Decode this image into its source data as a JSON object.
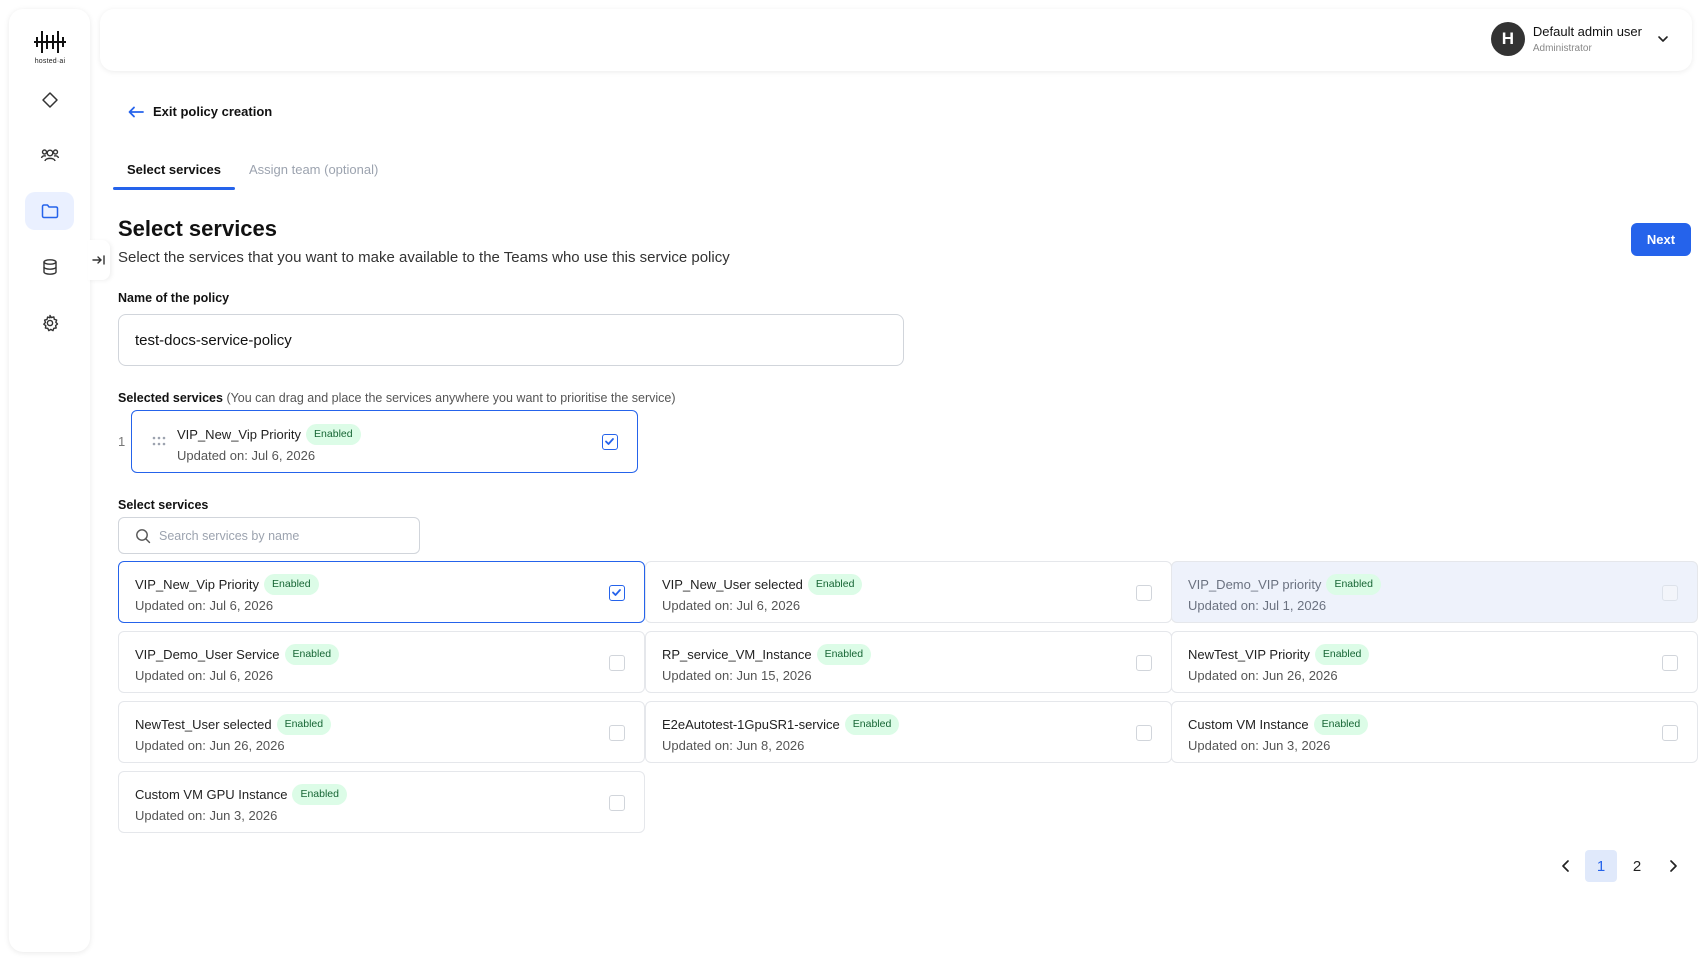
{
  "app": {
    "logo_text": "hosted·ai"
  },
  "sidebar": {
    "items": [
      {
        "name": "diamond-icon"
      },
      {
        "name": "users-icon"
      },
      {
        "name": "folder-icon",
        "active": true
      },
      {
        "name": "database-icon"
      },
      {
        "name": "gear-icon"
      }
    ],
    "collapse_icon": "collapse-right-icon"
  },
  "header": {
    "user": {
      "initial": "H",
      "name": "Default admin user",
      "role": "Administrator"
    }
  },
  "exit_link": "Exit policy creation",
  "tabs": [
    {
      "label": "Select services",
      "active": true
    },
    {
      "label": "Assign team (optional)",
      "active": false
    }
  ],
  "page": {
    "title": "Select services",
    "subtitle": "Select the services that you want to make available to the Teams who use this service policy",
    "next_label": "Next"
  },
  "policy_name": {
    "label": "Name of the policy",
    "value": "test-docs-service-policy"
  },
  "selected_services": {
    "label": "Selected services",
    "hint": "(You can drag and place the services anywhere you want to prioritise the service)",
    "items": [
      {
        "index": "1",
        "name": "VIP_New_Vip Priority",
        "status": "Enabled",
        "updated": "Updated on: Jul 6, 2026"
      }
    ]
  },
  "select_services": {
    "label": "Select services",
    "search_placeholder": "Search services by name",
    "services": [
      {
        "name": "VIP_New_Vip Priority",
        "status": "Enabled",
        "updated": "Updated on: Jul 6, 2026",
        "checked": true
      },
      {
        "name": "VIP_New_User selected",
        "status": "Enabled",
        "updated": "Updated on: Jul 6, 2026",
        "checked": false
      },
      {
        "name": "VIP_Demo_VIP priority",
        "status": "Enabled",
        "updated": "Updated on: Jul 1, 2026",
        "checked": false,
        "disabled": true
      },
      {
        "name": "VIP_Demo_User Service",
        "status": "Enabled",
        "updated": "Updated on: Jul 6, 2026",
        "checked": false
      },
      {
        "name": "RP_service_VM_Instance",
        "status": "Enabled",
        "updated": "Updated on: Jun 15, 2026",
        "checked": false
      },
      {
        "name": "NewTest_VIP Priority",
        "status": "Enabled",
        "updated": "Updated on: Jun 26, 2026",
        "checked": false
      },
      {
        "name": "NewTest_User selected",
        "status": "Enabled",
        "updated": "Updated on: Jun 26, 2026",
        "checked": false
      },
      {
        "name": "E2eAutotest-1GpuSR1-service",
        "status": "Enabled",
        "updated": "Updated on: Jun 8, 2026",
        "checked": false
      },
      {
        "name": "Custom VM Instance",
        "status": "Enabled",
        "updated": "Updated on: Jun 3, 2026",
        "checked": false
      },
      {
        "name": "Custom VM GPU Instance",
        "status": "Enabled",
        "updated": "Updated on: Jun 3, 2026",
        "checked": false
      }
    ]
  },
  "pagination": {
    "pages": [
      "1",
      "2"
    ],
    "current": "1"
  },
  "colors": {
    "accent": "#2563eb",
    "badge_bg": "#dcfce7",
    "badge_text": "#166534",
    "active_nav_bg": "#eaf0ff"
  }
}
